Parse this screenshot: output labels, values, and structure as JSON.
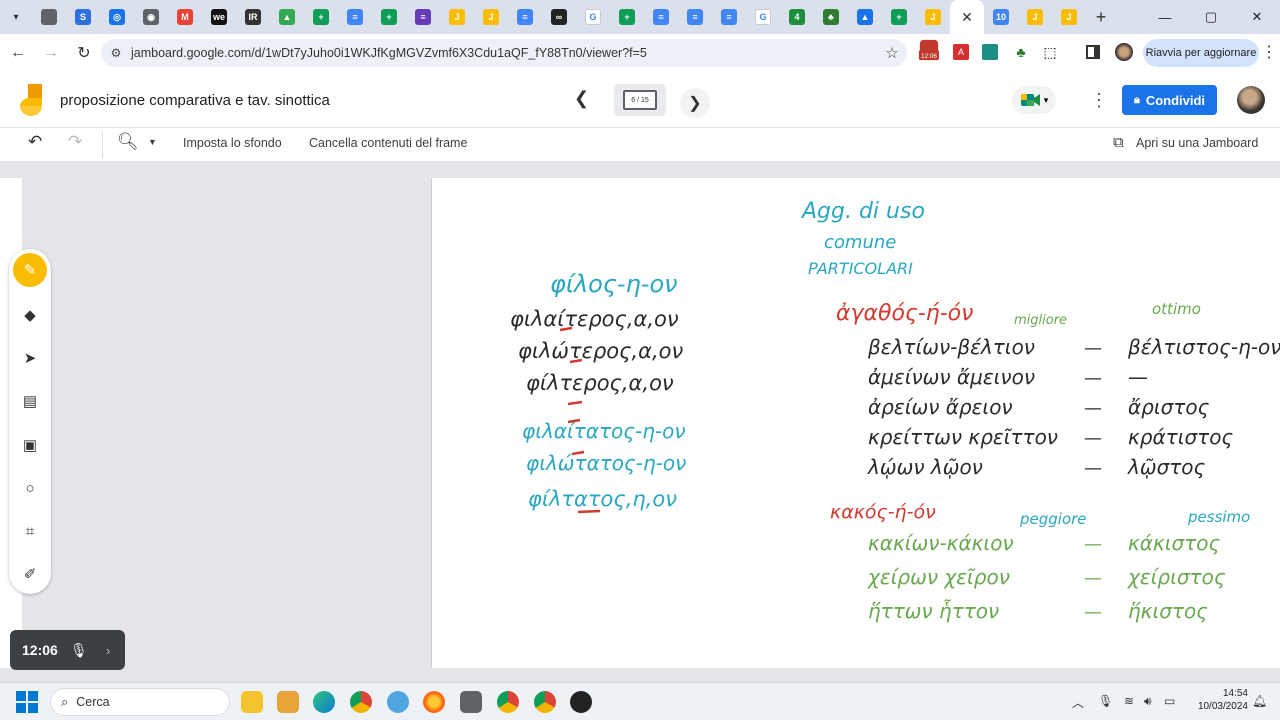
{
  "browser": {
    "tab_favicons": [
      "tab-favicon-globe",
      "tab-favicon-s",
      "tab-favicon-circle",
      "tab-favicon-chrome",
      "tab-favicon-gmail",
      "tab-favicon-we",
      "tab-favicon-ir",
      "tab-favicon-drive",
      "tab-favicon-sheets",
      "tab-favicon-docs",
      "tab-favicon-sheets",
      "tab-favicon-forms",
      "tab-favicon-jamboard",
      "tab-favicon-jamboard",
      "tab-favicon-docs",
      "tab-favicon-link",
      "tab-favicon-google",
      "tab-favicon-sheets",
      "tab-favicon-docs",
      "tab-favicon-docs",
      "tab-favicon-docs",
      "tab-favicon-google",
      "tab-favicon-classroom",
      "tab-favicon-tree",
      "tab-favicon-contacts",
      "tab-favicon-sheets",
      "tab-favicon-jamboard"
    ],
    "active_tab_close": "✕",
    "after_tabs_favicons": [
      "tab-favicon-calendar",
      "tab-favicon-jamboard",
      "tab-favicon-jamboard"
    ],
    "new_tab": "+",
    "url": "jamboard.google.com/d/1wDt7yJuho0i1WKJfKgMGVZvmf6X3Cdu1aQF_fY88Tn0/viewer?f=5",
    "update_button": "Riavvia per aggiornare",
    "ext_badge": "12:06"
  },
  "jamboard": {
    "title": "proposizione comparativa e tav. sinottica",
    "frame_indicator": "6 / 15",
    "share_button": "Condividi",
    "toolbar": {
      "set_background": "Imposta lo sfondo",
      "clear_frame": "Cancella contenuti del frame",
      "open_in_jamboard": "Apri su una Jamboard"
    }
  },
  "canvas": {
    "left_block": {
      "heading": "φίλος-η-ον",
      "comparatives": [
        "φιλαίτερος,α,ον",
        "φιλώτερος,α,ον",
        "φίλτερος,α,ον"
      ],
      "superlatives": [
        "φιλαίτατος-η-ον",
        "φιλώτατος-η-ον",
        "φίλτατος,η,ον"
      ]
    },
    "right_block": {
      "heading_lines": [
        "Agg. di uso",
        "comune",
        "PARTICOLARI"
      ],
      "group1_label": "ἀγαθός-ή-όν",
      "group1_note_comp": "migliore",
      "group1_note_sup": "ottimo",
      "group1_rows": [
        [
          "βελτίων-βέλτιον",
          "—",
          "βέλτιστος-η-ον"
        ],
        [
          "ἀμείνων ἄμεινον",
          "—",
          "—"
        ],
        [
          "ἀρείων ἄρειον",
          "—",
          "ἄριστος"
        ],
        [
          "κρείττων κρεῖττον",
          "—",
          "κράτιστος"
        ],
        [
          "λῴων λῷον",
          "—",
          "λῷστος"
        ]
      ],
      "group2_label": "κακός-ή-όν",
      "group2_note_comp": "peggiore",
      "group2_note_sup": "pessimo",
      "group2_rows": [
        [
          "κακίων-κάκιον",
          "—",
          "κάκιστος"
        ],
        [
          "χείρων χεῖρον",
          "—",
          "χείριστος"
        ],
        [
          "ἥττων ἧττον",
          "—",
          "ἥκιστος"
        ]
      ]
    },
    "colors": {
      "teal": "#2aa7c0",
      "dark": "#2b2b2b",
      "red": "#d03a2f",
      "green": "#6aa84f",
      "brand_blue": "#1a73e8",
      "jam_yellow": "#fbbc04"
    }
  },
  "widget": {
    "time": "12:06"
  },
  "taskbar": {
    "search_placeholder": "Cerca",
    "time": "14:54",
    "date": "10/03/2024"
  }
}
